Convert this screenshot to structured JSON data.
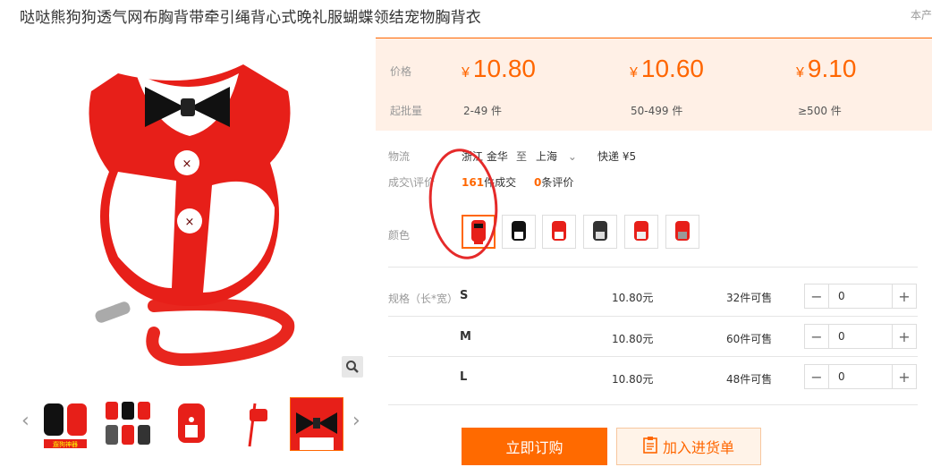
{
  "product": {
    "title": "哒哒熊狗狗透气网布胸背带牵引绳背心式晚礼服蝴蝶领结宠物胸背衣",
    "corner_text": "本产"
  },
  "gallery": {
    "zoom_icon": "magnifier-icon",
    "thumb_count": 5,
    "selected_thumb": 5,
    "thumb_badge": "遛狗神器"
  },
  "pricing": {
    "price_label": "价格",
    "moq_label": "起批量",
    "currency": "¥",
    "tiers": [
      {
        "price": "10.80",
        "range": "2-49 件"
      },
      {
        "price": "10.60",
        "range": "50-499 件"
      },
      {
        "price": "9.10",
        "range": "≥500 件"
      }
    ]
  },
  "logistics": {
    "label": "物流",
    "from": "浙江 金华",
    "to_word": "至",
    "to": "上海",
    "shipping": "快递 ¥5"
  },
  "sales": {
    "label": "成交\\评价",
    "sold_count": "161",
    "sold_suffix": "件成交",
    "review_count": "0",
    "review_suffix": "条评价"
  },
  "color": {
    "label": "颜色",
    "swatch_count": 6,
    "selected_index": 0
  },
  "specs": {
    "label": "规格（长*宽）",
    "rows": [
      {
        "size": "S",
        "price": "10.80元",
        "stock": "32件可售",
        "qty": "0"
      },
      {
        "size": "M",
        "price": "10.80元",
        "stock": "60件可售",
        "qty": "0"
      },
      {
        "size": "L",
        "price": "10.80元",
        "stock": "48件可售",
        "qty": "0"
      }
    ]
  },
  "actions": {
    "buy_label": "立即订购",
    "cart_label": "加入进货单"
  },
  "colors": {
    "accent": "#ff6600",
    "price_bg": "#fff0e6",
    "annotation": "#e52a2a"
  }
}
